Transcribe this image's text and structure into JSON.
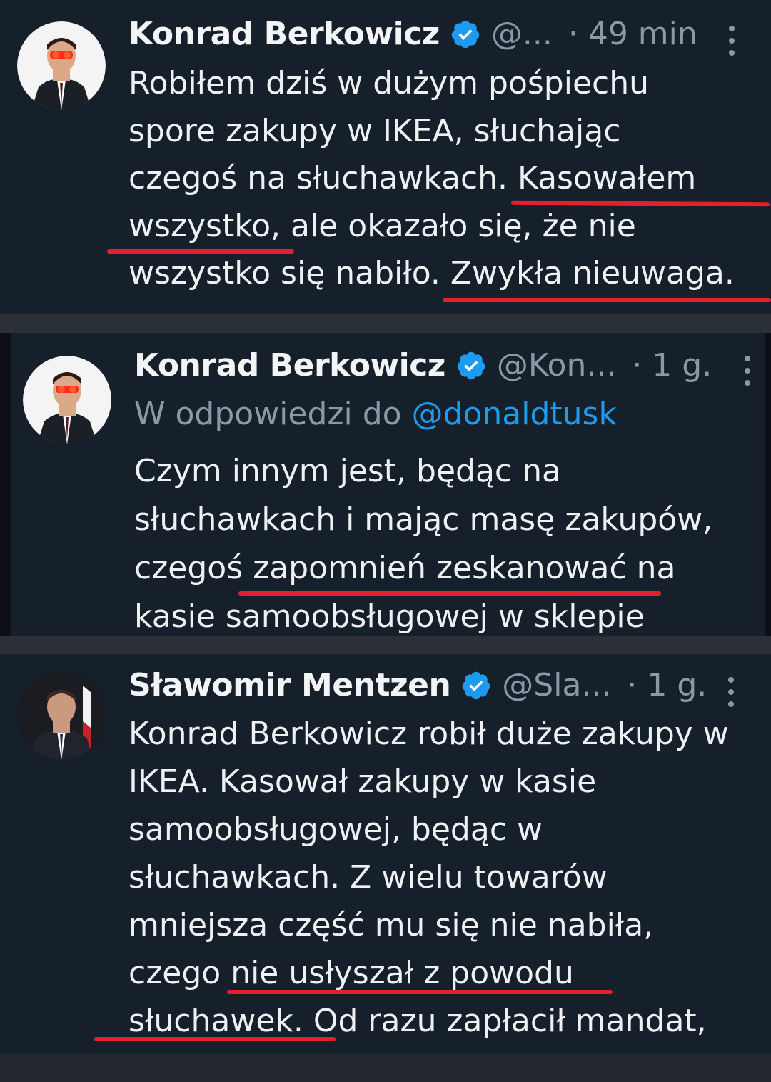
{
  "tweets": [
    {
      "author": "Konrad Berkowicz",
      "handle": "@...",
      "time": "· 49 min",
      "body_lines": [
        "Robiłem dziś w dużym pośpiechu",
        "spore zakupy w IKEA, słuchając",
        "czegoś na słuchawkach. Kasowałem",
        "wszystko, ale okazało się, że nie",
        "wszystko się nabiło. Zwykła nieuwaga."
      ]
    },
    {
      "author": "Konrad Berkowicz",
      "handle": "@Kon...",
      "time": "· 1 g.",
      "reply_prefix": "W odpowiedzi do ",
      "reply_mention": "@donaldtusk",
      "body_lines": [
        "Czym innym jest, będąc na",
        "słuchawkach i mając masę zakupów,",
        "czegoś zapomnień zeskanować na",
        "kasie samoobsługowej w sklepie"
      ]
    },
    {
      "author": "Sławomir Mentzen",
      "handle": "@Sla...",
      "time": "· 1 g.",
      "body_lines": [
        "Konrad Berkowicz robił duże zakupy w",
        "IKEA. Kasował zakupy w kasie",
        "samoobsługowej, będąc w",
        "słuchawkach. Z wielu towarów",
        "mniejsza część mu się nie nabiła,",
        "czego nie usłyszał z powodu",
        "słuchawek. Od razu zapłacił mandat,"
      ]
    }
  ],
  "colors": {
    "background": "#15202b",
    "verified": "#1d9bf0",
    "mention": "#1d9bf0",
    "annotation_underline": "#e3202b",
    "secondary_text": "#8b98a5"
  },
  "icons": [
    "verified-badge-icon",
    "more-options-icon"
  ]
}
